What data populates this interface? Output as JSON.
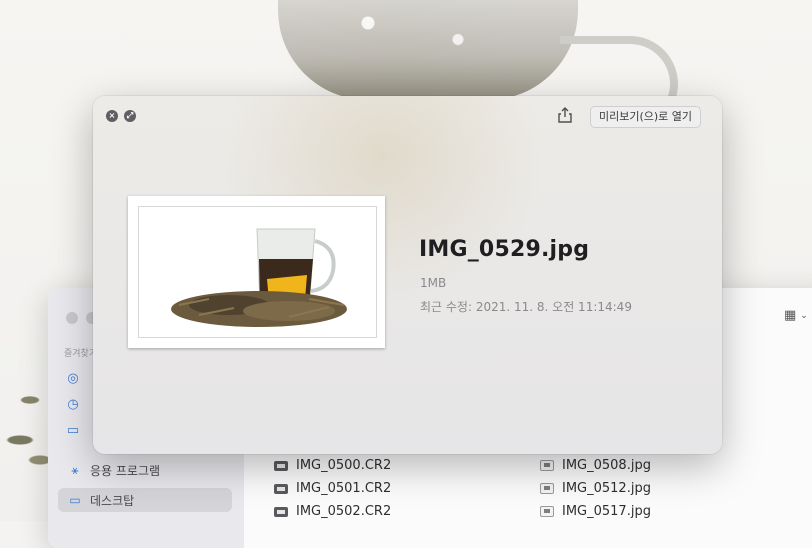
{
  "quicklook": {
    "open_button": "미리보기(으)로 열기",
    "file_name": "IMG_0529.jpg",
    "file_size": "1MB",
    "modified": "최근 수정: 2021. 11. 8. 오전 11:14:49",
    "close_icon": "close-icon",
    "fullscreen_icon": "fullscreen-icon",
    "share_icon": "share-icon"
  },
  "finder": {
    "sidebar": {
      "section": "즐겨찾기",
      "items": [
        {
          "label": "응용 프로그램",
          "icon": "applications-icon"
        },
        {
          "label": "데스크탑",
          "icon": "desktop-icon"
        }
      ]
    },
    "view_icon": "grid-view-icon",
    "files_col1": [
      "IMG_0500.CR2",
      "IMG_0501.CR2",
      "IMG_0502.CR2"
    ],
    "files_col2": [
      "IMG_0508.jpg",
      "IMG_0512.jpg",
      "IMG_0517.jpg"
    ]
  },
  "colors": {
    "accent": "#3a7bd5",
    "panel_bg": "#e8e7e8"
  }
}
